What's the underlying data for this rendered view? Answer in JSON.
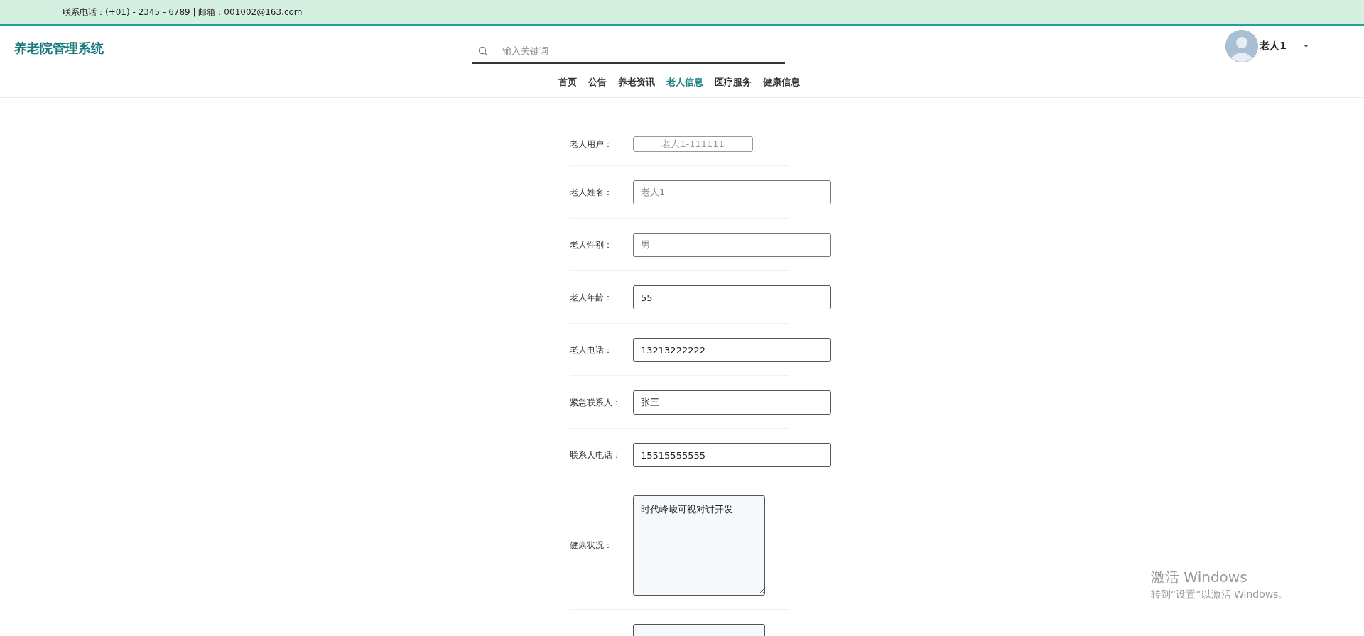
{
  "contact_bar": {
    "text": "联系电话：(+01) - 2345 - 6789 | 邮箱：001002@163.com"
  },
  "header": {
    "site_title": "养老院管理系统",
    "search": {
      "placeholder": "输入关键词"
    },
    "user": {
      "name": "老人1"
    }
  },
  "nav": [
    {
      "label": "首页",
      "selected": false
    },
    {
      "label": "公告",
      "selected": false
    },
    {
      "label": "养老资讯",
      "selected": false
    },
    {
      "label": "老人信息",
      "selected": true
    },
    {
      "label": "医疗服务",
      "selected": false
    },
    {
      "label": "健康信息",
      "selected": false
    }
  ],
  "form": {
    "fields": [
      {
        "kind": "input",
        "label": "老人用户：",
        "value": "老人1-111111",
        "disabled": true,
        "readonly": true
      },
      {
        "kind": "input",
        "label": "老人姓名：",
        "value": "老人1",
        "disabled": false,
        "readonly": true
      },
      {
        "kind": "input",
        "label": "老人性别：",
        "value": "男",
        "disabled": false,
        "readonly": true
      },
      {
        "kind": "input",
        "label": "老人年龄：",
        "value": "55",
        "disabled": false,
        "readonly": false
      },
      {
        "kind": "input",
        "label": "老人电话：",
        "value": "13213222222",
        "disabled": false,
        "readonly": false
      },
      {
        "kind": "input",
        "label": "紧急联系人：",
        "value": "张三",
        "disabled": false,
        "readonly": false
      },
      {
        "kind": "input",
        "label": "联系人电话：",
        "value": "15515555555",
        "disabled": false,
        "readonly": false
      },
      {
        "kind": "textarea",
        "label": "健康状况：",
        "value": "时代峰峻可视对讲开发",
        "disabled": false,
        "readonly": false
      },
      {
        "kind": "textarea",
        "disabled": false,
        "readonly": false
      }
    ]
  },
  "os_notice": {
    "title": "激活 Windows",
    "text": "转到“设置”以激活 Windows。"
  }
}
